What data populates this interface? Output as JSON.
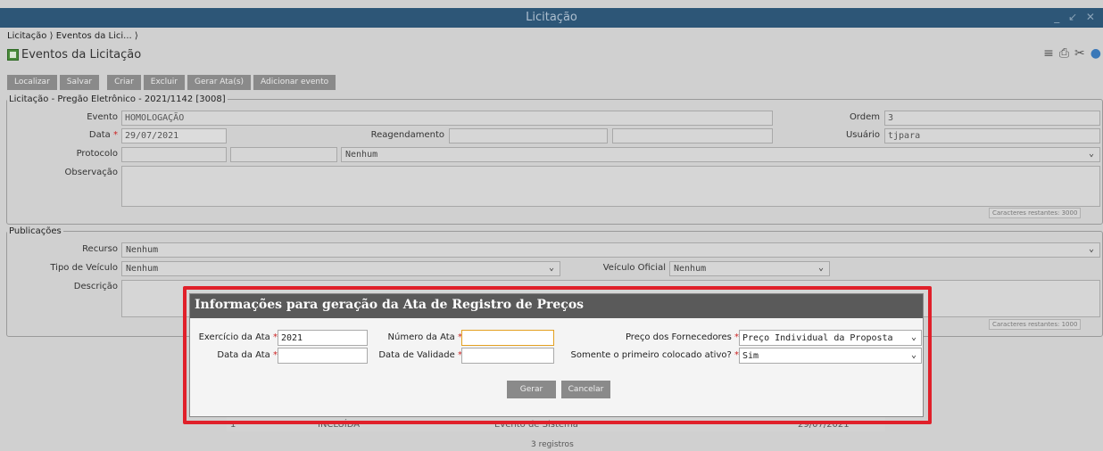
{
  "window": {
    "title": "Licitação",
    "controls": "_ ↙ ✕"
  },
  "breadcrumb": {
    "items": [
      "Licitação",
      "Eventos da Lici..."
    ]
  },
  "page": {
    "title": "Eventos da Licitação"
  },
  "toolbar": {
    "localizar": "Localizar",
    "salvar": "Salvar",
    "criar": "Criar",
    "excluir": "Excluir",
    "gerar_atas": "Gerar Ata(s)",
    "adicionar_evento": "Adicionar evento"
  },
  "licitacao": {
    "legend": "Licitação - Pregão Eletrônico - 2021/1142 [3008]",
    "evento_label": "Evento",
    "evento_value": "HOMOLOGAÇÃO",
    "ordem_label": "Ordem",
    "ordem_value": "3",
    "data_label": "Data",
    "data_value": "29/07/2021",
    "reagendamento_label": "Reagendamento",
    "usuario_label": "Usuário",
    "usuario_value": "tjpara",
    "protocolo_label": "Protocolo",
    "protocolo_select": "Nenhum",
    "observacao_label": "Observação",
    "chars_remaining": "Caracteres restantes: 3000"
  },
  "publicacoes": {
    "legend": "Publicações",
    "recurso_label": "Recurso",
    "recurso_value": "Nenhum",
    "tipo_veiculo_label": "Tipo de Veículo",
    "tipo_veiculo_value": "Nenhum",
    "veiculo_oficial_label": "Veículo Oficial",
    "veiculo_oficial_value": "Nenhum",
    "descricao_label": "Descrição",
    "chars_remaining": "Caracteres restantes: 1000"
  },
  "grid": {
    "row": {
      "c1": "1",
      "c2": "INCLUÍDA",
      "c3": "Evento de Sistema",
      "c4": "29/07/2021"
    },
    "records": "3 registros"
  },
  "modal": {
    "title": "Informações para geração da Ata de Registro de Preços",
    "exercicio_label": "Exercício da Ata",
    "exercicio_value": "2021",
    "numero_label": "Número da Ata",
    "numero_value": "",
    "preco_label": "Preço dos Fornecedores",
    "preco_value": "Preço Individual da Proposta",
    "data_label": "Data da Ata",
    "data_value": "",
    "validade_label": "Data de Validade",
    "validade_value": "",
    "primeiro_label": "Somente o primeiro colocado ativo?",
    "primeiro_value": "Sim",
    "gerar": "Gerar",
    "cancelar": "Cancelar"
  },
  "colors": {
    "titlebar": "#2d5677",
    "highlight": "#e0202a",
    "modal_header": "#5a5a5a",
    "required": "#cc2222"
  }
}
